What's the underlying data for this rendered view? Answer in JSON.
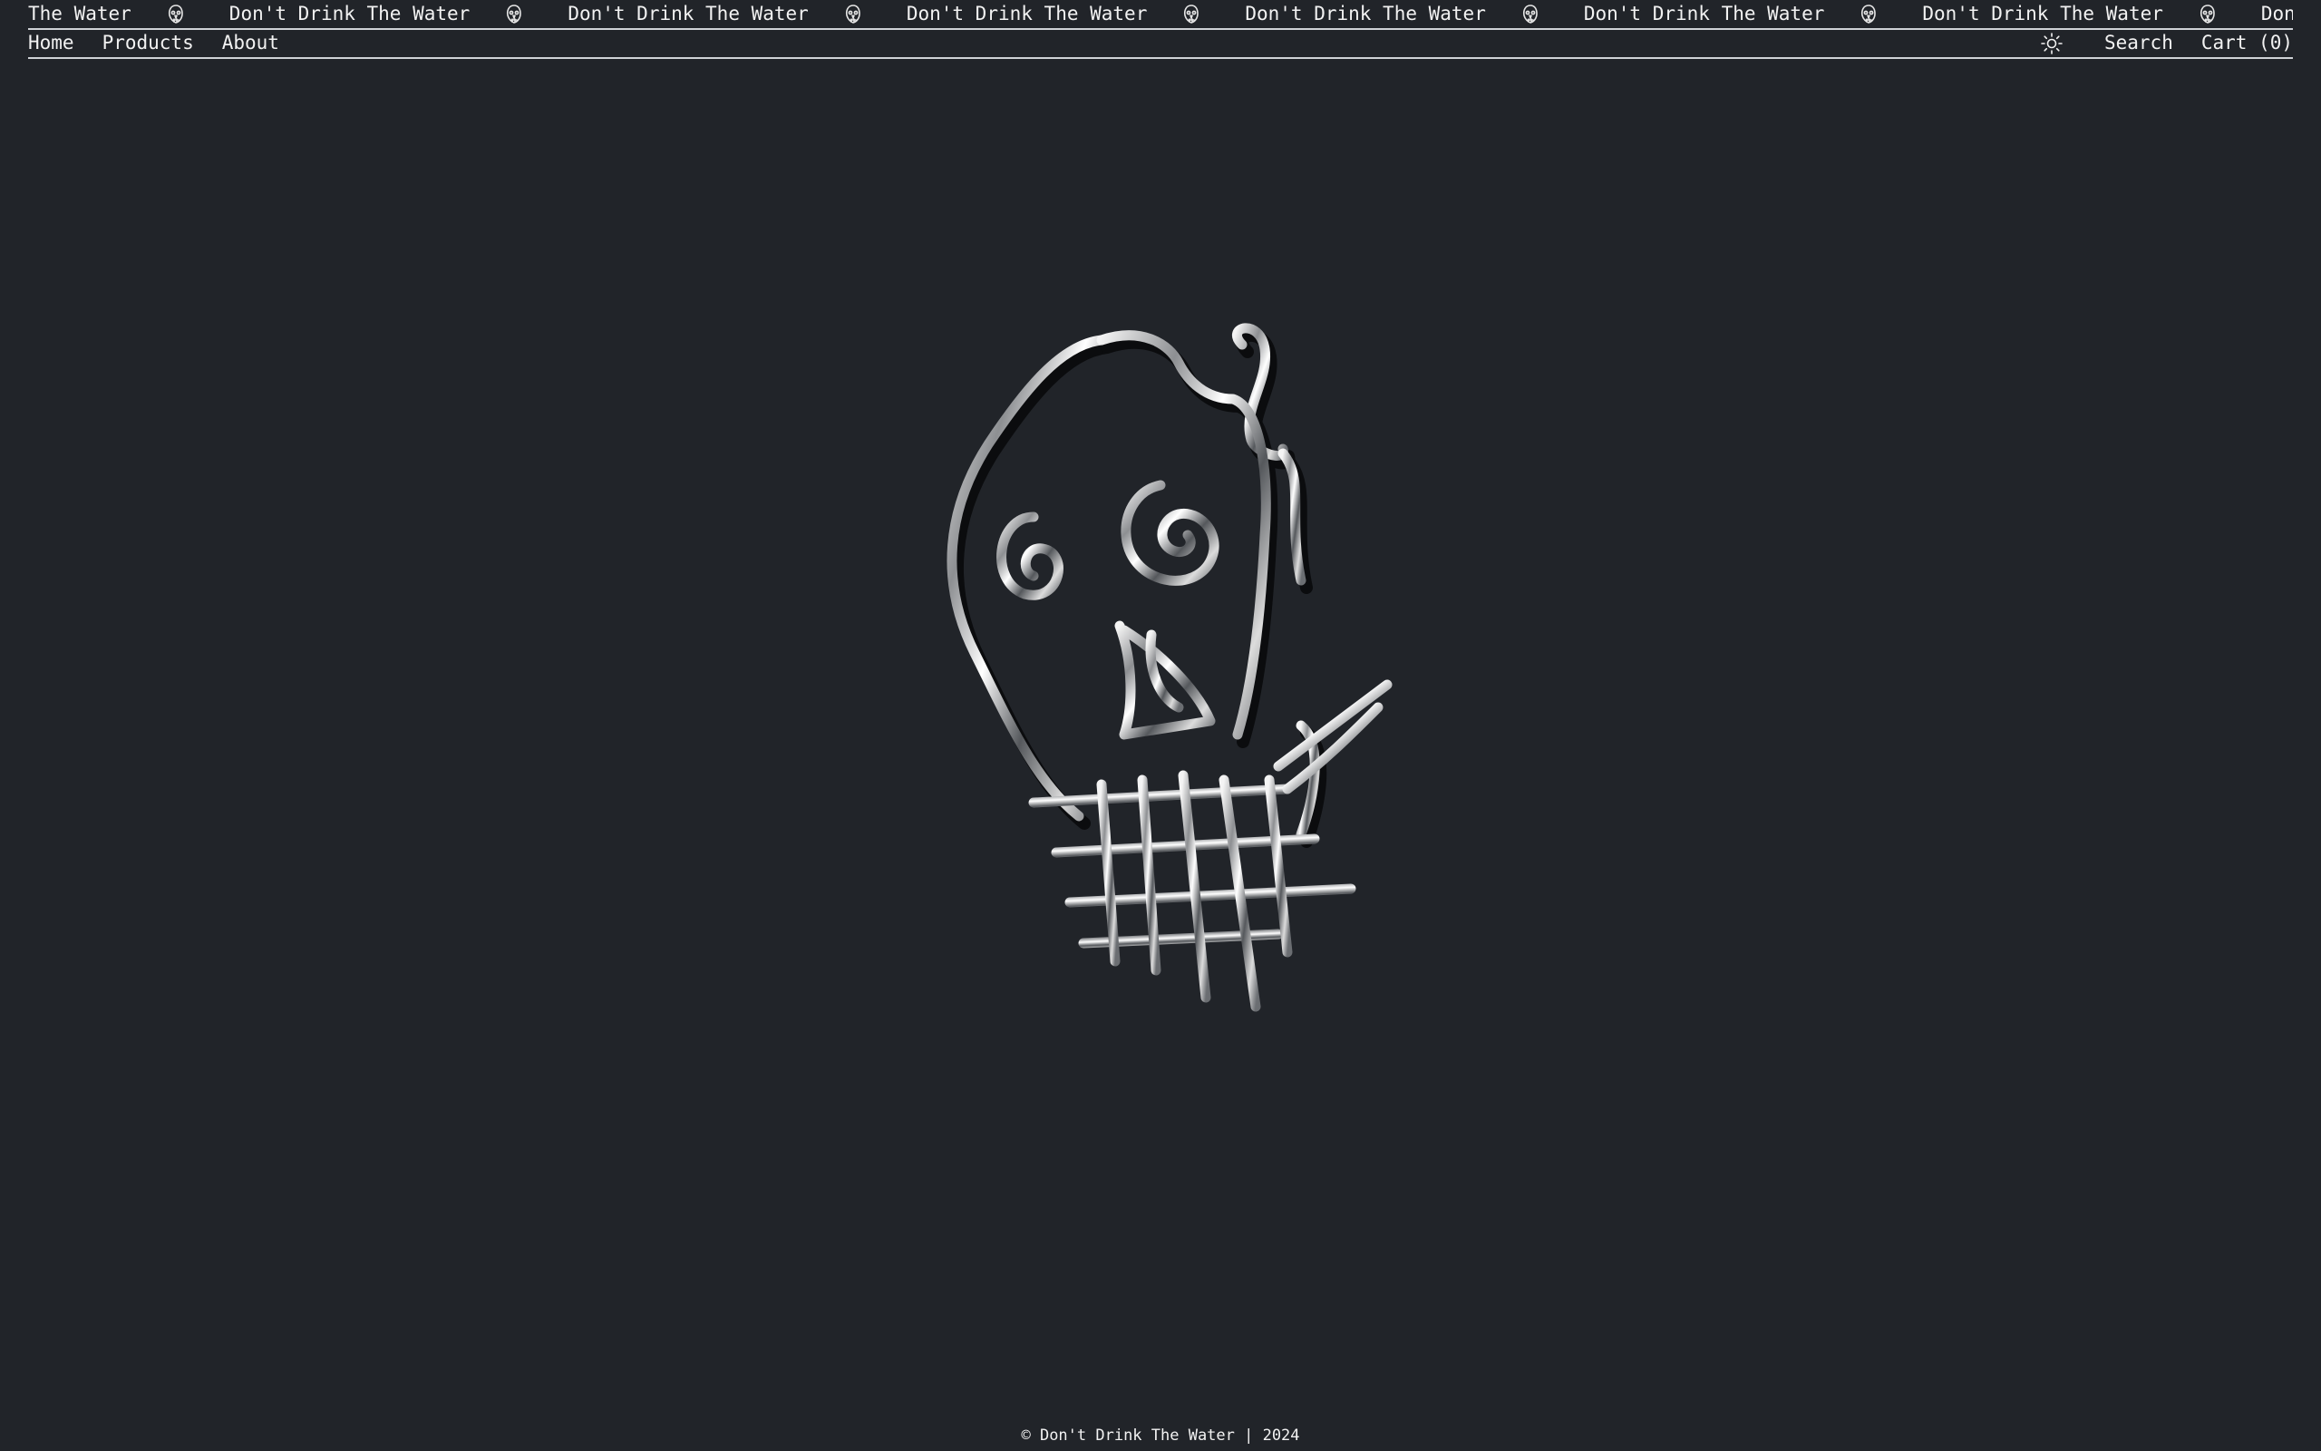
{
  "marquee": {
    "items": [
      "The Water",
      "Don't Drink The Water",
      "Don't Drink The Water",
      "Don't Drink The Water",
      "Don't Drink The Water",
      "Don't Drink The Water",
      "Don't Drink The Water",
      "Don't Drink The Water"
    ],
    "separator_icon": "skull-icon"
  },
  "nav": {
    "home": "Home",
    "products": "Products",
    "about": "About",
    "theme_icon": "sun-icon",
    "search": "Search",
    "cart": "Cart (0)"
  },
  "hero": {
    "image": "chrome-skull-with-smoke-illustration"
  },
  "footer": {
    "copyright_symbol": "©",
    "text": "Don't Drink The Water | 2024"
  },
  "colors": {
    "background": "#212429",
    "text": "#f2f2f2",
    "rule": "#cfd2d6",
    "chrome_light": "#e9e9e9",
    "chrome_dark": "#0b0c0e"
  }
}
